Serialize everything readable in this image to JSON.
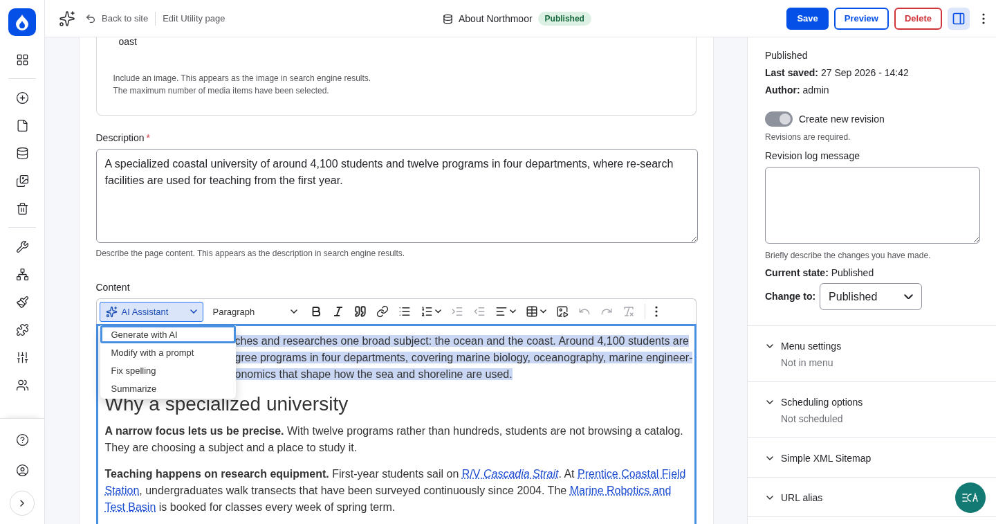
{
  "topbar": {
    "back": "Back to site",
    "page": "Edit Utility page",
    "title": "About Northmoor",
    "status": "Published",
    "buttons": [
      {
        "label": "Save",
        "kind": "primary"
      },
      {
        "label": "Preview",
        "kind": "outline"
      },
      {
        "label": "Delete",
        "kind": "danger"
      }
    ],
    "sidebar_toggle": {
      "selected": true
    }
  },
  "media": {
    "value": "oast",
    "help": [
      "Include an image. This appears as the image in search engine results.",
      "The maximum number of media items have been selected."
    ]
  },
  "description": {
    "label": "Description",
    "required_mark": "*",
    "value": "A specialized coastal university of around 4,100 students and twelve programs in four departments, where re-search facilities are used for teaching from the first year.",
    "help": "Describe the page content. This appears as the description in search engine results."
  },
  "content": {
    "label": "Content",
    "toolbar": {
      "ai": "AI Assistant",
      "format": "Paragraph",
      "buttons": [
        {
          "disabled": false,
          "menu": false
        },
        {
          "disabled": false,
          "menu": false
        },
        {
          "disabled": false,
          "menu": false
        },
        {
          "disabled": false,
          "menu": false
        },
        {
          "disabled": false,
          "menu": false
        },
        {
          "disabled": false,
          "menu": true
        },
        {
          "disabled": true,
          "menu": false
        },
        {
          "disabled": true,
          "menu": false
        },
        {
          "disabled": false,
          "menu": true
        },
        {
          "disabled": false,
          "menu": true
        },
        {
          "disabled": false,
          "menu": false
        },
        {
          "disabled": true,
          "menu": false
        },
        {
          "disabled": true,
          "menu": false
        },
        {
          "disabled": true,
          "menu": false
        }
      ]
    },
    "ai_menu": [
      {
        "label": "Generate with AI",
        "selected": true
      },
      {
        "label": "Modify with a prompt",
        "selected": false
      },
      {
        "label": "Fix spelling",
        "selected": false
      },
      {
        "label": "Summarize",
        "selected": false
      }
    ],
    "blocks": [
      {
        "kind": "paragraph",
        "selected": true,
        "lines": [
          [
            {
              "kind": "text",
              "text": "ches and researches one broad subject: the ocean and the coast. Around 4,100 students are"
            }
          ],
          [
            {
              "kind": "text",
              "text": "gree programs in four departments, covering marine biology, oceanography, marine engineer-"
            }
          ],
          [
            {
              "kind": "text",
              "text": "onomics that shape how the sea and shoreline are used."
            }
          ]
        ]
      },
      {
        "kind": "heading",
        "selected": false,
        "lines": [
          [
            {
              "kind": "text",
              "text": "Why a specialized university"
            }
          ]
        ]
      },
      {
        "kind": "paragraph",
        "selected": false,
        "lines": [
          [
            {
              "kind": "strong",
              "text": "A narrow focus lets us be precise."
            },
            {
              "kind": "text",
              "text": " With twelve programs rather than hundreds, students are not browsing a catalog."
            }
          ],
          [
            {
              "kind": "text",
              "text": "They are choosing a subject and a place to study it."
            }
          ]
        ]
      },
      {
        "kind": "paragraph",
        "selected": false,
        "lines": [
          [
            {
              "kind": "strong",
              "text": "Teaching happens on research equipment."
            },
            {
              "kind": "text",
              "text": " First-year students sail on "
            },
            {
              "kind": "link",
              "text": "R/V *Cascadia Strait*"
            },
            {
              "kind": "text",
              "text": ". At "
            },
            {
              "kind": "link",
              "text": "Prentice Coastal Field"
            }
          ],
          [
            {
              "kind": "link",
              "text": "Station"
            },
            {
              "kind": "text",
              "text": ", undergraduates walk transects that have been surveyed continuously since 2004. The "
            },
            {
              "kind": "link",
              "text": "Marine Robotics and"
            }
          ],
          [
            {
              "kind": "link",
              "text": "Test Basin"
            },
            {
              "kind": "text",
              "text": " is booked for classes every week of spring term."
            }
          ]
        ]
      }
    ]
  },
  "sidebar": {
    "status": "Published",
    "meta": [
      {
        "label": "Last saved:",
        "value": "27 Sep 2026 - 14:42"
      },
      {
        "label": "Author:",
        "value": "admin"
      }
    ],
    "revision": {
      "label": "Create new revision",
      "on": true,
      "disabled": true,
      "help": "Revisions are required."
    },
    "log": {
      "label": "Revision log message",
      "help": "Briefly describe the changes you have made."
    },
    "current_state": {
      "label": "Current state:",
      "value": "Published"
    },
    "change_to": {
      "label": "Change to:",
      "value": "Published"
    },
    "sections": [
      {
        "title": "Menu settings",
        "summary": "Not in menu",
        "expanded": false
      },
      {
        "title": "Scheduling options",
        "summary": "Not scheduled",
        "expanded": false
      },
      {
        "title": "Simple XML Sitemap",
        "expanded": false
      },
      {
        "title": "URL alias",
        "expanded": false
      }
    ]
  }
}
